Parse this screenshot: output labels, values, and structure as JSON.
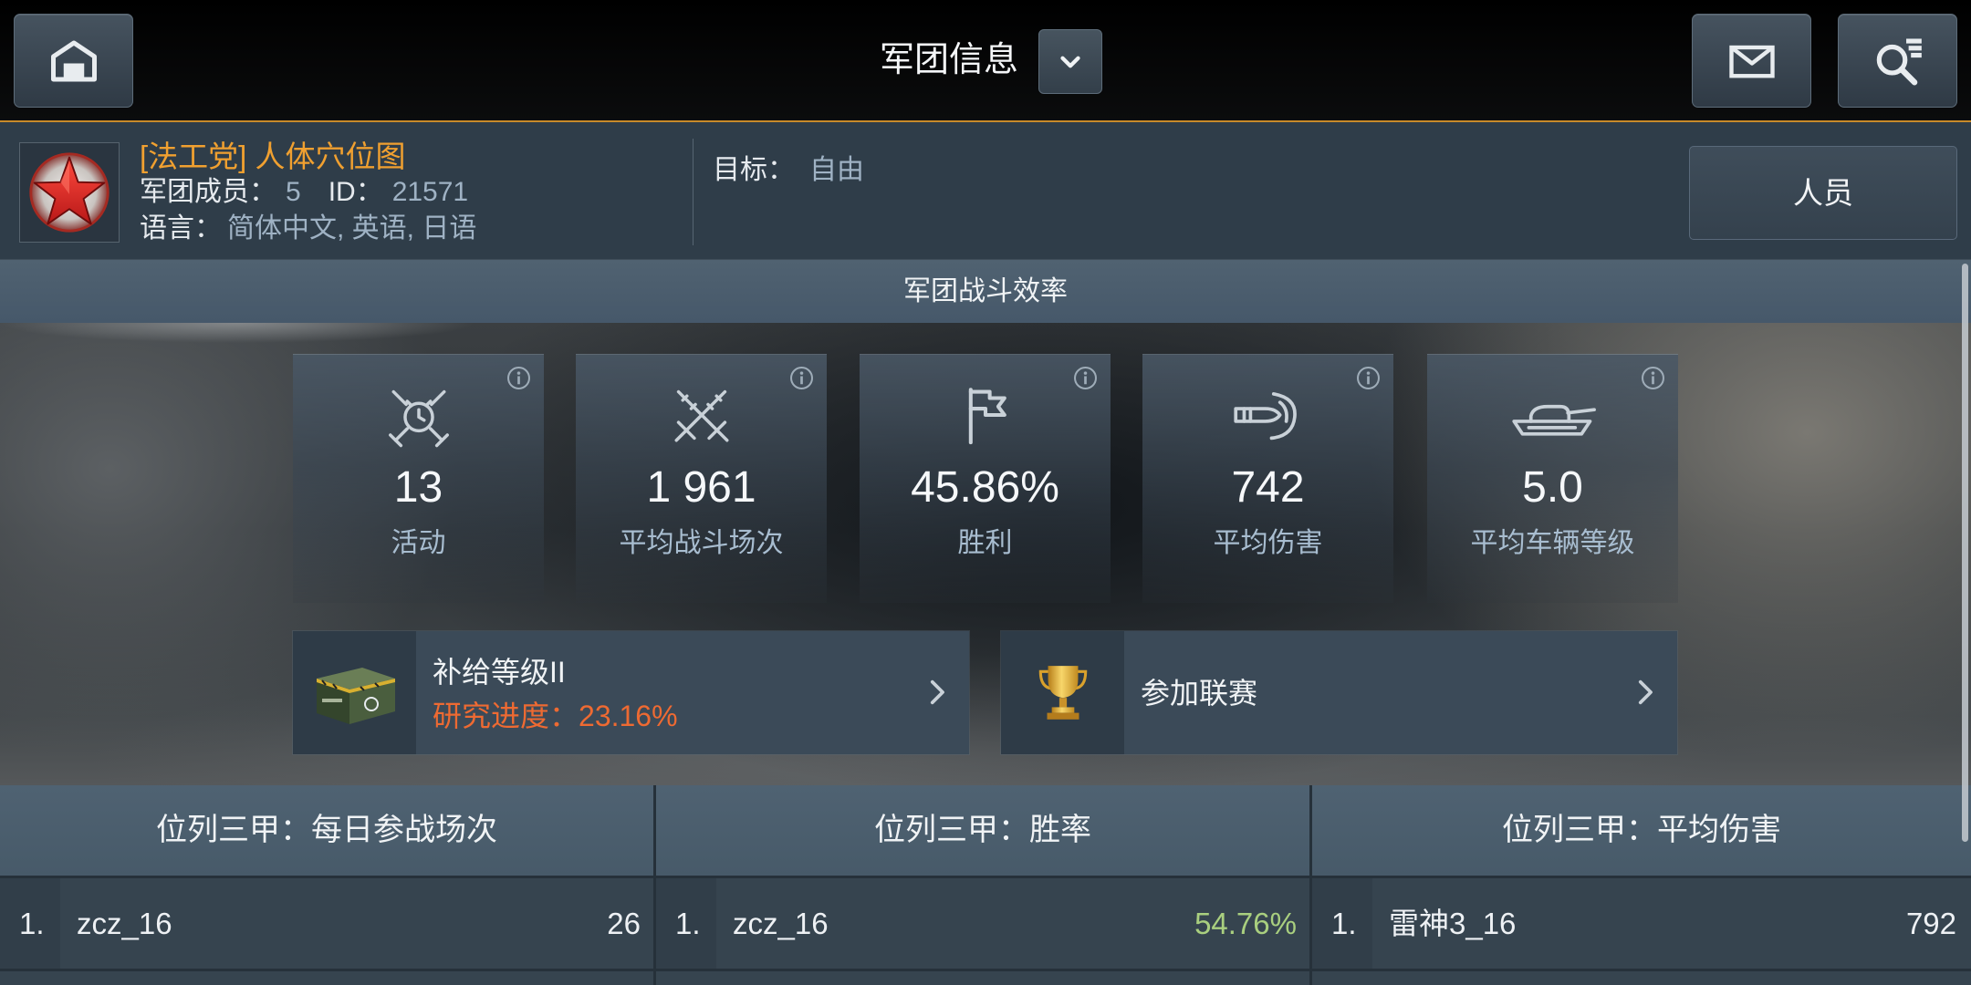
{
  "header": {
    "title": "军团信息",
    "home_icon": "home-icon",
    "dropdown_icon": "chevron-down-icon",
    "mail_icon": "mail-icon",
    "search_icon": "search-icon"
  },
  "clan": {
    "emblem_icon": "red-star-emblem-icon",
    "name": "[法工党] 人体穴位图",
    "members_label": "军团成员：",
    "members_value": "5",
    "id_label": "ID：",
    "id_value": "21571",
    "languages_label": "语言：",
    "languages_value": "简体中文, 英语, 日语",
    "goal_label": "目标：",
    "goal_value": "自由",
    "members_button_label": "人员"
  },
  "efficiency": {
    "title": "军团战斗效率",
    "stats": [
      {
        "icon": "activity-icon",
        "value": "13",
        "label": "活动"
      },
      {
        "icon": "crossed-swords-icon",
        "value": "1 961",
        "label": "平均战斗场次"
      },
      {
        "icon": "flag-icon",
        "value": "45.86%",
        "label": "胜利"
      },
      {
        "icon": "shell-icon",
        "value": "742",
        "label": "平均伤害"
      },
      {
        "icon": "tank-icon",
        "value": "5.0",
        "label": "平均车辆等级"
      }
    ]
  },
  "supply": {
    "icon": "supply-crate-icon",
    "title": "补给等级II",
    "progress_label": "研究进度：",
    "progress_value": "23.16%"
  },
  "league": {
    "icon": "trophy-icon",
    "title": "参加联赛"
  },
  "top3": [
    {
      "title": "位列三甲：每日参战场次",
      "rows": [
        {
          "rank": "1.",
          "name": "zcz_16",
          "value": "26"
        }
      ]
    },
    {
      "title": "位列三甲：胜率",
      "rows": [
        {
          "rank": "1.",
          "name": "zcz_16",
          "value": "54.76%"
        }
      ]
    },
    {
      "title": "位列三甲：平均伤害",
      "rows": [
        {
          "rank": "1.",
          "name": "雷神3_16",
          "value": "792"
        }
      ]
    }
  ],
  "colors": {
    "accent_orange": "#f0a030",
    "progress_orange": "#ee6a32",
    "win_rate_green": "#a9cf7f",
    "top_bar_line": "#c88a2a"
  }
}
